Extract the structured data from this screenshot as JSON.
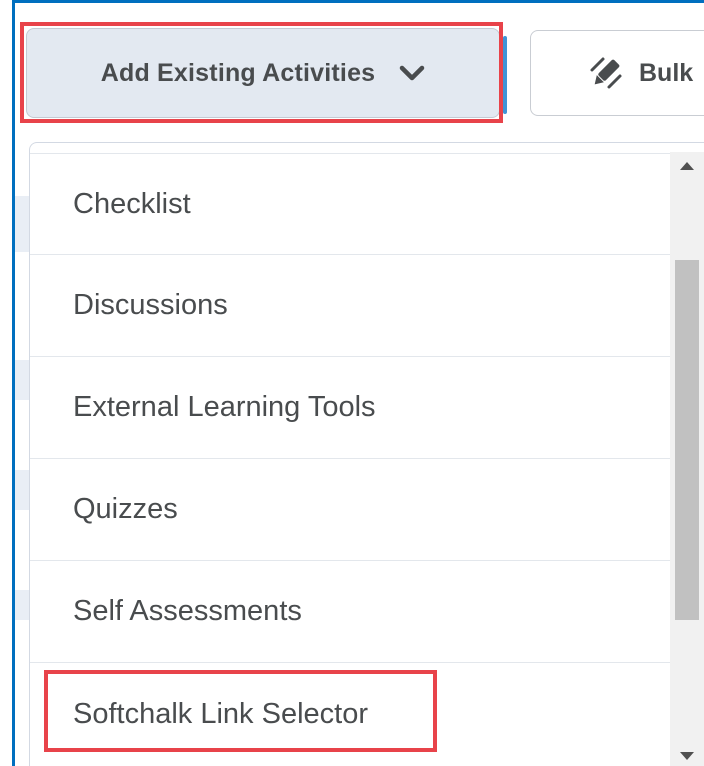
{
  "toolbar": {
    "add_existing_label": "Add Existing Activities",
    "bulk_label": "Bulk"
  },
  "menu": {
    "items": [
      {
        "label": "Checklist"
      },
      {
        "label": "Discussions"
      },
      {
        "label": "External Learning Tools"
      },
      {
        "label": "Quizzes"
      },
      {
        "label": "Self Assessments"
      },
      {
        "label": "Softchalk Link Selector"
      }
    ]
  },
  "icons": {
    "dropdown": "chevron-down-icon",
    "bulk": "pencil-icon",
    "scroll_up": "arrow-up-icon",
    "scroll_down": "arrow-down-icon"
  },
  "colors": {
    "highlight": "#e8434a",
    "button_bg": "#e3e9f1",
    "text": "#494c4e",
    "frame_accent": "#006fbf"
  }
}
